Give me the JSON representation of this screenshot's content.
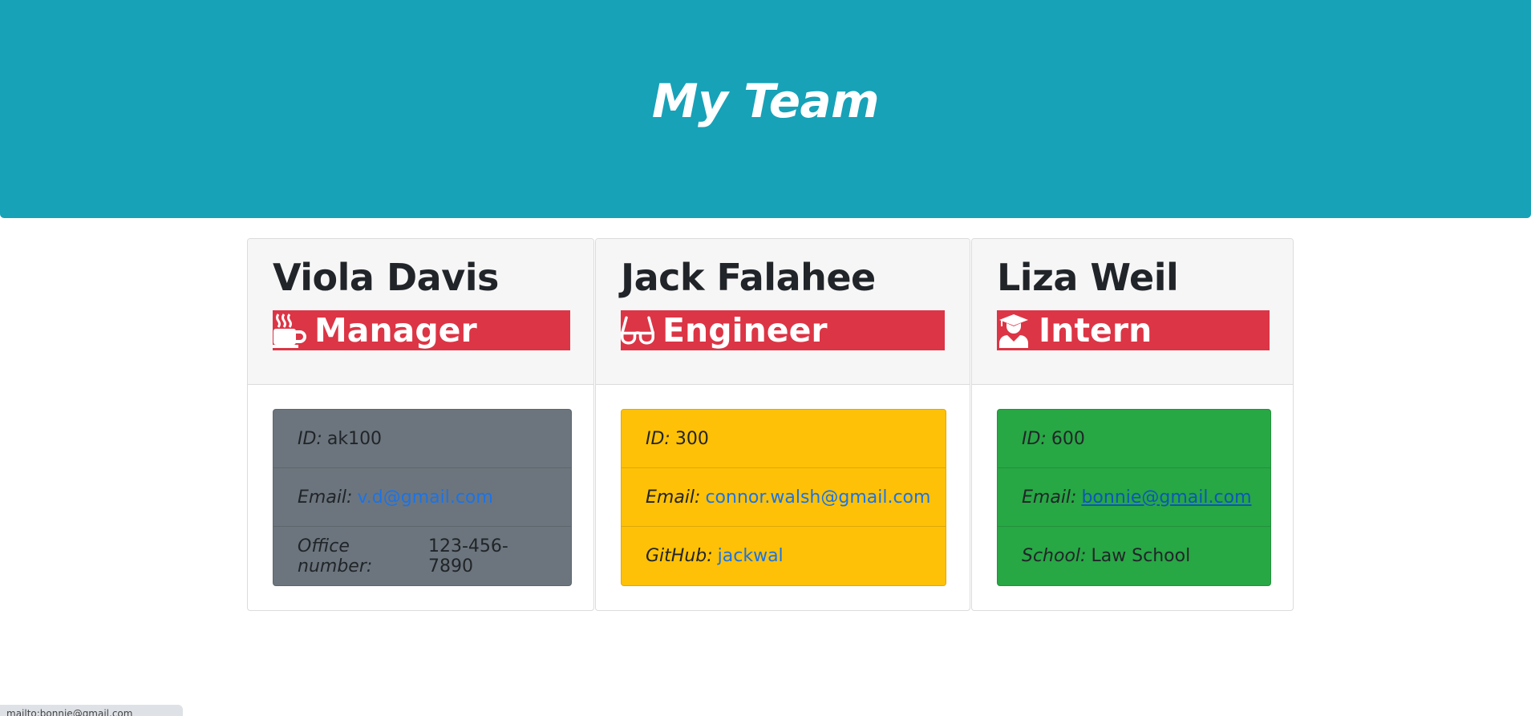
{
  "header": {
    "title": "My Team"
  },
  "cards": [
    {
      "name": "Viola Davis",
      "role": "Manager",
      "icon": "coffee-mug-icon",
      "items": [
        {
          "label": "ID:",
          "value": "ak100"
        },
        {
          "label": "Email:",
          "value": "v.d@gmail.com"
        },
        {
          "label": "Office number:",
          "value": "123-456-7890"
        }
      ]
    },
    {
      "name": "Jack Falahee",
      "role": "Engineer",
      "icon": "glasses-icon",
      "items": [
        {
          "label": "ID:",
          "value": "300"
        },
        {
          "label": "Email:",
          "value": "connor.walsh@gmail.com"
        },
        {
          "label": "GitHub:",
          "value": "jackwal"
        }
      ]
    },
    {
      "name": "Liza Weil",
      "role": "Intern",
      "icon": "graduate-icon",
      "items": [
        {
          "label": "ID:",
          "value": "600"
        },
        {
          "label": "Email:",
          "value": "bonnie@gmail.com"
        },
        {
          "label": "School:",
          "value": "Law School"
        }
      ]
    }
  ],
  "status_bar": {
    "text": "mailto:bonnie@gmail.com"
  },
  "colors": {
    "header_bg": "#17a2b8",
    "role_bg": "#dc3545",
    "manager_list_bg": "#6c757d",
    "engineer_list_bg": "#ffc107",
    "intern_list_bg": "#28a745",
    "link": "#1a73e8"
  }
}
